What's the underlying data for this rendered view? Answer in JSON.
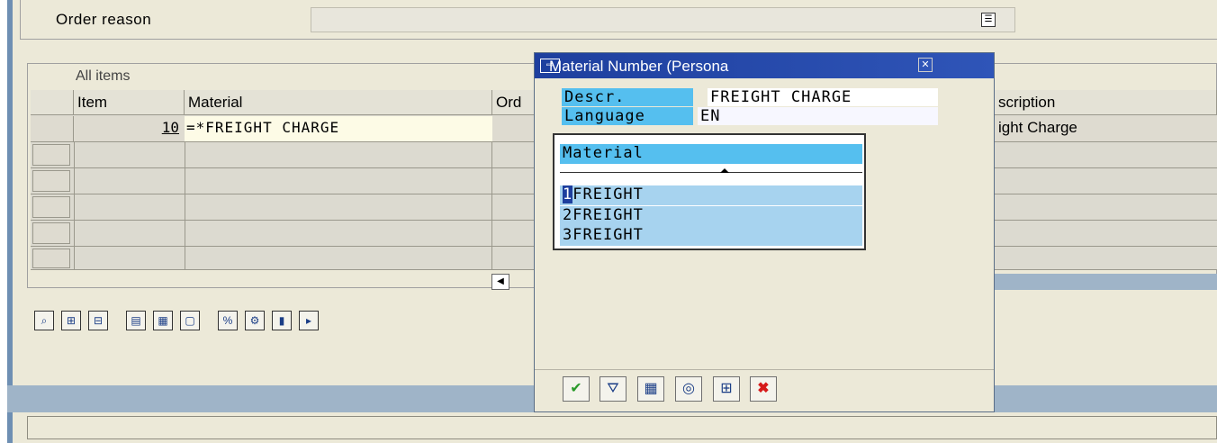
{
  "header": {
    "order_reason_label": "Order reason",
    "order_reason_value": ""
  },
  "items": {
    "title": "All items",
    "columns": [
      "Item",
      "Material",
      "Ord",
      "scription"
    ],
    "rows": [
      {
        "item": "10",
        "material": "=*FREIGHT CHARGE",
        "description": "ight Charge"
      }
    ]
  },
  "popup": {
    "title": "Material Number (Persona",
    "descr_label": "Descr.",
    "descr_value": "FREIGHT CHARGE",
    "language_label": "Language",
    "language_value": "EN",
    "hit_list_header": "Material",
    "hits": [
      {
        "num": "1",
        "value": "FREIGHT"
      },
      {
        "num": "2",
        "value": "FREIGHT"
      },
      {
        "num": "3",
        "value": "FREIGHT"
      }
    ]
  },
  "icons": {
    "order_reason_f4": "dropdown-list-icon",
    "popup_buttons": [
      "check-icon",
      "filter-icon",
      "new-search-icon",
      "display-icon",
      "find-icon",
      "cancel-icon"
    ]
  },
  "colors": {
    "title_bar": "#1e3f9e",
    "highlight_label": "#55bfef",
    "hit_row": "#a7d3ef",
    "cancel": "#d61a1a",
    "check": "#2a9a2a"
  }
}
